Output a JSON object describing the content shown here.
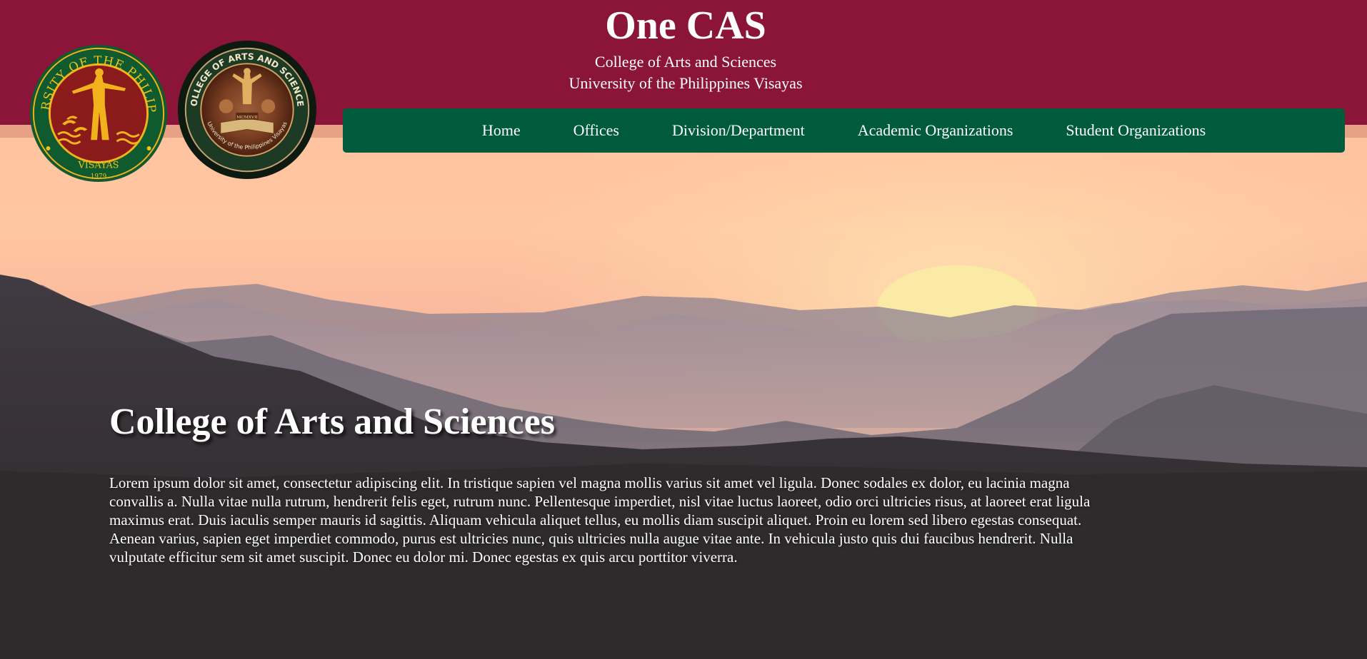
{
  "header": {
    "title": "One CAS",
    "subtitle_1": "College of Arts and Sciences",
    "subtitle_2": "University of the Philippines Visayas"
  },
  "logos": {
    "up_seal_text": "UNIVERSITY OF THE PHILIPPINES · VISAYAS · 1979",
    "cas_seal_text": "COLLEGE OF ARTS AND SCIENCES · University of the Philippines Visayas · MCMXVII"
  },
  "nav": {
    "items": [
      {
        "label": "Home"
      },
      {
        "label": "Offices"
      },
      {
        "label": "Division/Department"
      },
      {
        "label": "Academic Organizations"
      },
      {
        "label": "Student Organizations"
      }
    ]
  },
  "main": {
    "heading": "College of Arts and Sciences",
    "body": "Lorem ipsum dolor sit amet, consectetur adipiscing elit. In tristique sapien vel magna mollis varius sit amet vel ligula. Donec sodales ex dolor, eu lacinia magna convallis a. Nulla vitae nulla rutrum, hendrerit felis eget, rutrum nunc. Pellentesque imperdiet, nisl vitae luctus laoreet, odio orci ultricies risus, at laoreet erat ligula maximus erat. Duis iaculis semper mauris id sagittis. Aliquam vehicula aliquet tellus, eu mollis diam suscipit aliquet. Proin eu lorem sed libero egestas consequat. Aenean varius, sapien eget imperdiet commodo, purus est ultricies nunc, quis ultricies nulla augue vitae ante. In vehicula justo quis dui faucibus hendrerit. Nulla vulputate efficitur sem sit amet suscipit. Donec eu dolor mi. Donec egestas ex quis arcu porttitor viverra."
  },
  "colors": {
    "header_maroon": "#8a1538",
    "nav_green": "#005a3c",
    "sky_peach": "#f9b796",
    "sun_yellow": "#fbe9a8"
  }
}
